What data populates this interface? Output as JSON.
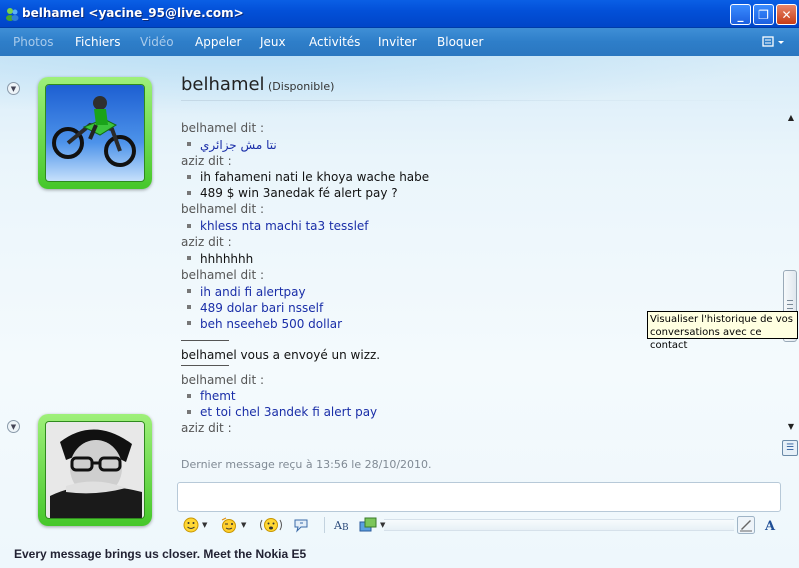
{
  "window": {
    "title": "belhamel <yacine_95@live.com>",
    "controls": {
      "minimize": "_",
      "maximize": "❐",
      "close": "✕"
    }
  },
  "menu": {
    "items": [
      "Photos",
      "Fichiers",
      "Vidéo",
      "Appeler",
      "Jeux",
      "Activités",
      "Inviter",
      "Bloquer"
    ],
    "disabled": [
      "Photos",
      "Vidéo"
    ]
  },
  "contact": {
    "name": "belhamel",
    "status": "(Disponible)"
  },
  "conversation": [
    {
      "type": "speaker",
      "text": "belhamel dit :"
    },
    {
      "type": "message",
      "color": "blue",
      "text": "ﻧﺘﺎ ﻣﺶ ﺟﺰاﺋﺮي"
    },
    {
      "type": "speaker",
      "text": "aziz dit :"
    },
    {
      "type": "message",
      "color": "black",
      "text": "ih fahameni nati le khoya wache habe"
    },
    {
      "type": "message",
      "color": "black",
      "text": "489 $ win 3anedak fé alert pay ?"
    },
    {
      "type": "speaker",
      "text": "belhamel dit :"
    },
    {
      "type": "message",
      "color": "blue",
      "text": "khless nta machi ta3 tesslef"
    },
    {
      "type": "speaker",
      "text": "aziz dit :"
    },
    {
      "type": "message",
      "color": "black",
      "text": "hhhhhhh"
    },
    {
      "type": "speaker",
      "text": "belhamel dit :"
    },
    {
      "type": "message",
      "color": "blue",
      "text": "ih andi fi alertpay"
    },
    {
      "type": "message",
      "color": "blue",
      "text": "489 dolar bari nsself"
    },
    {
      "type": "message",
      "color": "blue",
      "text": "beh nseeheb 500 dollar"
    },
    {
      "type": "separator"
    },
    {
      "type": "notice",
      "text": "belhamel vous a envoyé un wizz."
    },
    {
      "type": "separator"
    },
    {
      "type": "speaker",
      "text": "belhamel dit :"
    },
    {
      "type": "message",
      "color": "blue",
      "text": "fhemt"
    },
    {
      "type": "message",
      "color": "blue",
      "text": "et toi chel 3andek fi alert pay"
    },
    {
      "type": "speaker",
      "text": "aziz dit :"
    }
  ],
  "last_message": "Dernier message reçu à 13:56 le 28/10/2010.",
  "tooltip": {
    "line1": "Visualiser l'historique de vos",
    "line2": "conversations avec ce contact"
  },
  "compose": {
    "value": ""
  },
  "toolbar": {
    "buttons": [
      "emoticon-icon",
      "wink-icon",
      "nudge-icon",
      "voice-clip-icon",
      "font-icon",
      "background-icon",
      "handwriting-icon",
      "text-format-icon"
    ]
  },
  "footer": {
    "ad_text": "Every message brings us closer. Meet the Nokia E5"
  },
  "colors": {
    "titlebar": "#0350d8",
    "menubar": "#2e7ec9",
    "avatar_frame": "#45c72a",
    "contact_message": "#1a2ea8"
  }
}
